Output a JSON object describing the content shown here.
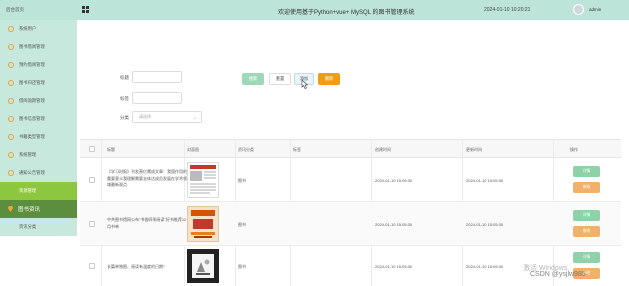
{
  "topbar": {
    "home_label": "后台首页",
    "title": "欢迎使用基于Python+vue+ MySQL 的图书管理系统",
    "datetime": "2024-01-10 10:20:21",
    "username": "admin"
  },
  "sidebar": {
    "items": [
      {
        "label": "系统用户"
      },
      {
        "label": "图书借阅管理"
      },
      {
        "label": "预约借阅管理"
      },
      {
        "label": "图书归还管理"
      },
      {
        "label": "借阅逾期管理"
      },
      {
        "label": "图书信息管理"
      },
      {
        "label": "书籍类型管理"
      },
      {
        "label": "系统管理"
      },
      {
        "label": "通知公告管理"
      },
      {
        "label": "资源管理"
      },
      {
        "label": "图书资讯"
      },
      {
        "label": "资讯分类"
      }
    ]
  },
  "filters": {
    "title_label": "标题",
    "tags_label": "标签",
    "category_label": "分类",
    "category_placeholder": "请选择"
  },
  "buttons": {
    "search": "搜索",
    "reset": "重置",
    "add": "添加",
    "delete": "删除"
  },
  "table": {
    "headers": [
      "标题",
      "封面图",
      "资讯分类",
      "标签",
      "创建时间",
      "更新时间",
      "操作"
    ],
    "rows": [
      {
        "title": "《学习时报》刊发萧亿鹰成文章：我国作用的重要意义我理解需要去体达成员发展在学术领域最新观点",
        "category": "图书",
        "tags": "",
        "created": "2024-01-10 15:05:30",
        "updated": "2024-01-10 15:05:30"
      },
      {
        "title": "中共图书馆网公布\"书香四季阅读\"好书推荐12月书单",
        "category": "图书",
        "tags": "",
        "created": "2024-01-10 15:05:30",
        "updated": "2024-01-10 15:05:30"
      },
      {
        "title": "长篇单独图、阅读有温度的日期！",
        "category": "图书",
        "tags": "",
        "created": "2024-01-10 15:05:30",
        "updated": "2024-01-10 15:05:30"
      }
    ],
    "actions": {
      "detail": "详情",
      "edit": "修改"
    }
  },
  "watermark": {
    "line1": "激活 Windows",
    "line2": "CSDN @ysjlw985"
  },
  "colors": {
    "topbar_bg": "#bde4d8",
    "sidebar_bg": "#c6e8dd",
    "sidebar_active": "#8dc63f",
    "sidebar_dark": "#5b8f3d",
    "btn_search": "#9dd9b8",
    "btn_delete": "#f39c12"
  }
}
